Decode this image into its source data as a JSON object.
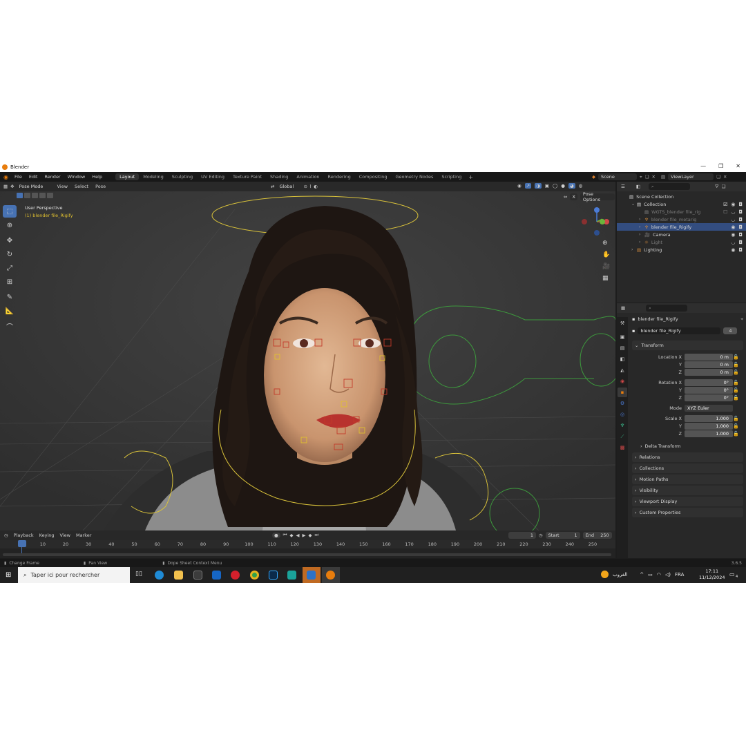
{
  "window": {
    "title": "Blender"
  },
  "menu": {
    "items": [
      "File",
      "Edit",
      "Render",
      "Window",
      "Help"
    ],
    "workspaces": [
      "Layout",
      "Modeling",
      "Sculpting",
      "UV Editing",
      "Texture Paint",
      "Shading",
      "Animation",
      "Rendering",
      "Compositing",
      "Geometry Nodes",
      "Scripting"
    ],
    "scene": "Scene",
    "view_layer": "ViewLayer"
  },
  "viewport": {
    "mode": "Pose Mode",
    "menus": [
      "View",
      "Select",
      "Pose"
    ],
    "orientation": "Global",
    "pose_options": "Pose Options",
    "overlay_title": "User Perspective",
    "overlay_subtitle": "(1) blender file_Rigify",
    "x_mirror_label": "X"
  },
  "outliner": {
    "rows": [
      {
        "label": "Scene Collection",
        "indent": 0,
        "state": "normal"
      },
      {
        "label": "Collection",
        "indent": 1,
        "state": "normal"
      },
      {
        "label": "WGTS_blender file_rig",
        "indent": 2,
        "state": "dim"
      },
      {
        "label": "blender file_metarig",
        "indent": 2,
        "state": "dim"
      },
      {
        "label": "blender file_Rigify",
        "indent": 2,
        "state": "selected"
      },
      {
        "label": "Camera",
        "indent": 2,
        "state": "normal"
      },
      {
        "label": "Light",
        "indent": 2,
        "state": "dim"
      },
      {
        "label": "Lighting",
        "indent": 1,
        "state": "normal"
      }
    ]
  },
  "properties": {
    "object_name": "blender file_Rigify",
    "data_name": "blender file_Rigify",
    "users": "4",
    "transform_title": "Transform",
    "location": {
      "label": "Location X",
      "x": "0 m",
      "y": "0 m",
      "z": "0 m"
    },
    "rotation": {
      "label": "Rotation X",
      "x": "0°",
      "y": "0°",
      "z": "0°"
    },
    "mode_label": "Mode",
    "mode_value": "XYZ Euler",
    "scale": {
      "label": "Scale X",
      "x": "1.000",
      "y": "1.000",
      "z": "1.000"
    },
    "axis_y": "Y",
    "axis_z": "Z",
    "delta_transform": "Delta Transform",
    "panels": [
      "Relations",
      "Collections",
      "Motion Paths",
      "Visibility",
      "Viewport Display",
      "Custom Properties"
    ]
  },
  "timeline": {
    "menus": [
      "Playback",
      "Keying",
      "View",
      "Marker"
    ],
    "current_frame": "1",
    "start_label": "Start",
    "start_value": "1",
    "end_label": "End",
    "end_value": "250",
    "ticks": [
      "1",
      "10",
      "20",
      "30",
      "40",
      "50",
      "60",
      "70",
      "80",
      "90",
      "100",
      "110",
      "120",
      "130",
      "140",
      "150",
      "160",
      "170",
      "180",
      "190",
      "200",
      "210",
      "220",
      "230",
      "240",
      "250"
    ]
  },
  "status": {
    "change_frame": "Change Frame",
    "pan_view": "Pan View",
    "context_menu": "Dope Sheet Context Menu",
    "version": "3.6.5"
  },
  "taskbar": {
    "search_placeholder": "Taper ici pour rechercher",
    "weather": "الغروب",
    "language": "FRA",
    "time": "17:11",
    "date": "11/12/2024",
    "notifications": "4"
  },
  "colors": {
    "accent": "#4772b3",
    "selected_row": "#334d80",
    "orange": "#e87d0d",
    "rig_yellow": "#e0c030",
    "rig_green": "#3d9a3d"
  }
}
